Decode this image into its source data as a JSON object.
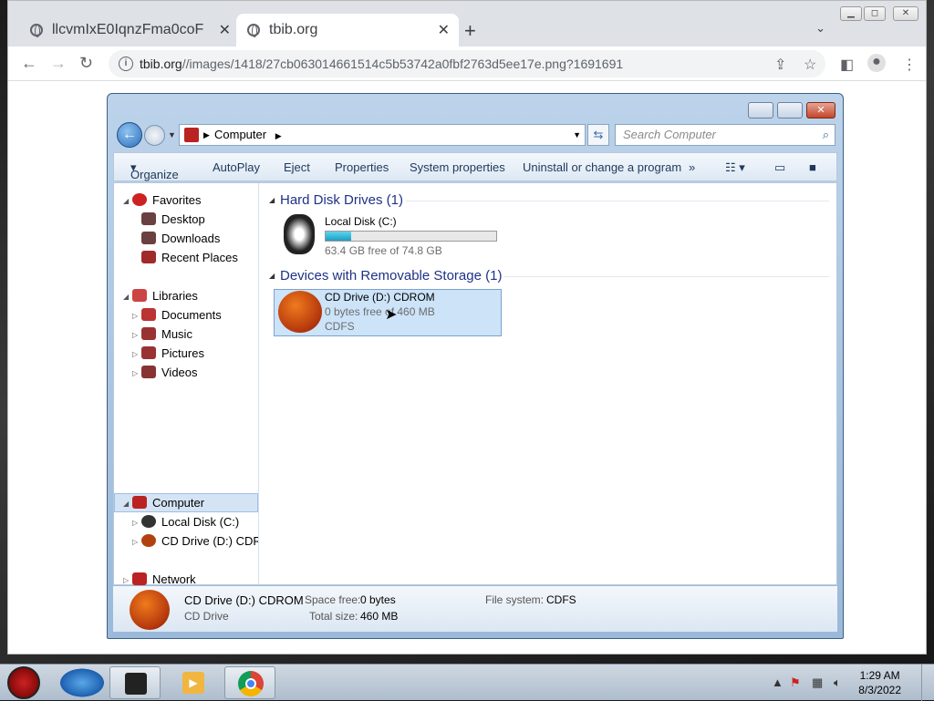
{
  "browser": {
    "tabs": [
      {
        "title": "llcvmIxE0IqnzFma0coF",
        "active": false
      },
      {
        "title": "tbib.org",
        "active": true
      }
    ],
    "url_domain": "tbib.org",
    "url_path": "//images/1418/27cb063014661514c5b53742a0fbf2763d5ee17e.png?1691691"
  },
  "explorer": {
    "breadcrumb": "Computer",
    "search_placeholder": "Search Computer",
    "commands": [
      "Organize",
      "AutoPlay",
      "Eject",
      "Properties",
      "System properties",
      "Uninstall or change a program",
      "»"
    ],
    "sidebar": {
      "favorites": {
        "label": "Favorites",
        "items": [
          "Desktop",
          "Downloads",
          "Recent Places"
        ]
      },
      "libraries": {
        "label": "Libraries",
        "items": [
          "Documents",
          "Music",
          "Pictures",
          "Videos"
        ]
      },
      "computer": {
        "label": "Computer",
        "items": [
          "Local Disk (C:)",
          "CD Drive (D:) CDROM"
        ]
      },
      "network": {
        "label": "Network"
      }
    },
    "groups": {
      "hdd": {
        "title": "Hard Disk Drives (1)",
        "name": "Local Disk (C:)",
        "free_text": "63.4 GB free of 74.8 GB",
        "used_fraction": 0.152
      },
      "removable": {
        "title": "Devices with Removable Storage (1)",
        "name": "CD Drive (D:) CDROM",
        "free_text": "0 bytes free of 460 MB",
        "fs": "CDFS"
      }
    },
    "details": {
      "name": "CD Drive (D:) CDROM",
      "type": "CD Drive",
      "space_free_label": "Space free:",
      "space_free": "0 bytes",
      "total_size_label": "Total size:",
      "total_size": "460 MB",
      "fs_label": "File system:",
      "fs": "CDFS"
    }
  },
  "taskbar": {
    "time": "1:29 AM",
    "date": "8/3/2022"
  }
}
